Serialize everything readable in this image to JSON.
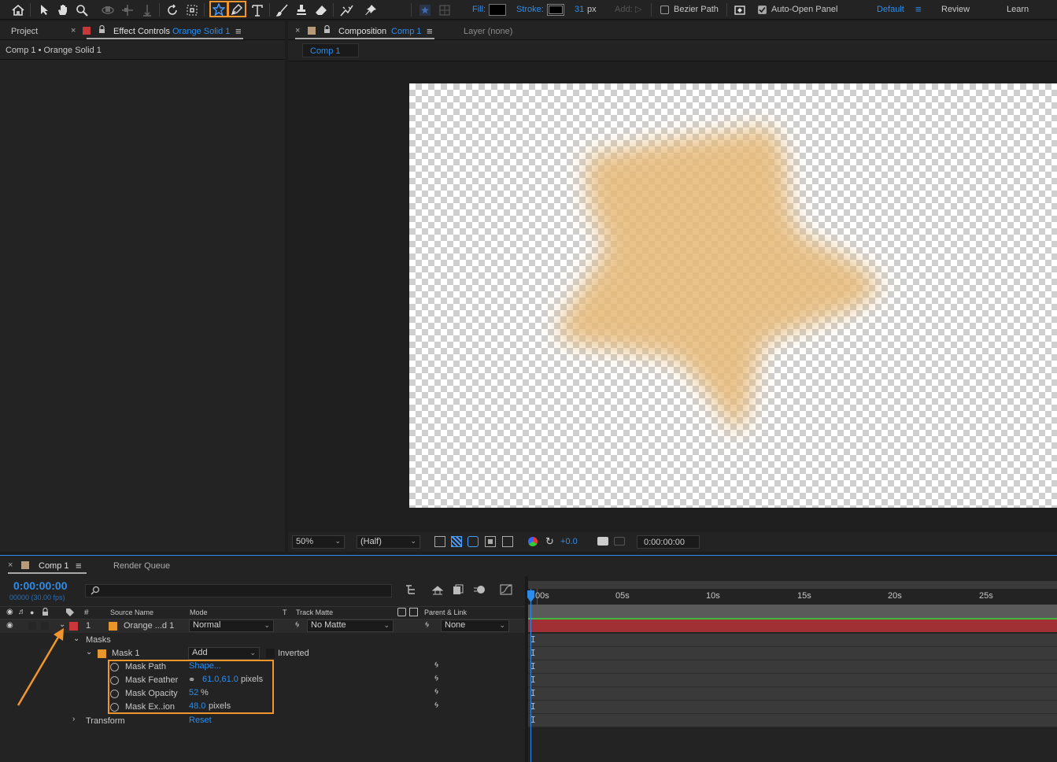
{
  "toolbar": {
    "fill_label": "Fill:",
    "stroke_label": "Stroke:",
    "stroke_width": "31",
    "stroke_unit": "px",
    "add_label": "Add:",
    "bezier_label": "Bezier Path",
    "auto_open_label": "Auto-Open Panel",
    "workspaces": [
      "Default",
      "Review",
      "Learn"
    ],
    "highlight_color": "#f0962d"
  },
  "left_panel": {
    "tab_project": "Project",
    "tab_effect": "Effect Controls",
    "tab_effect_target": "Orange Solid 1",
    "breadcrumb": "Comp 1 • Orange Solid 1"
  },
  "comp_panel": {
    "tab_label": "Composition",
    "tab_target": "Comp 1",
    "layer_tab": "Layer (none)",
    "sub_tab": "Comp 1",
    "zoom": "50%",
    "resolution": "(Half)",
    "exposure": "+0.0",
    "timecode": "0:00:00:00",
    "star_color": "#e6b877"
  },
  "timeline": {
    "tab_comp": "Comp 1",
    "tab_render": "Render Queue",
    "current_time": "0:00:00:00",
    "frame_info": "00000 (30.00 fps)",
    "col_hash": "#",
    "col_source": "Source Name",
    "col_mode": "Mode",
    "col_t": "T",
    "col_track": "Track Matte",
    "col_parent": "Parent & Link",
    "ruler": [
      "00s",
      "05s",
      "10s",
      "15s",
      "20s",
      "25s"
    ],
    "layer": {
      "num": "1",
      "name": "Orange ...d 1",
      "mode": "Normal",
      "matte": "No Matte",
      "parent": "None",
      "label_color": "#c8373a",
      "swatch_color": "#e6962d"
    },
    "masks_label": "Masks",
    "mask": {
      "name": "Mask 1",
      "mode": "Add",
      "inverted_label": "Inverted",
      "props": [
        {
          "name": "Mask Path",
          "value": "Shape...",
          "unit": ""
        },
        {
          "name": "Mask Feather",
          "value": "61.0,61.0",
          "unit": "pixels"
        },
        {
          "name": "Mask Opacity",
          "value": "52",
          "unit": "%"
        },
        {
          "name": "Mask Ex..ion",
          "value": "48.0",
          "unit": "pixels"
        }
      ]
    },
    "transform_label": "Transform",
    "transform_reset": "Reset"
  }
}
